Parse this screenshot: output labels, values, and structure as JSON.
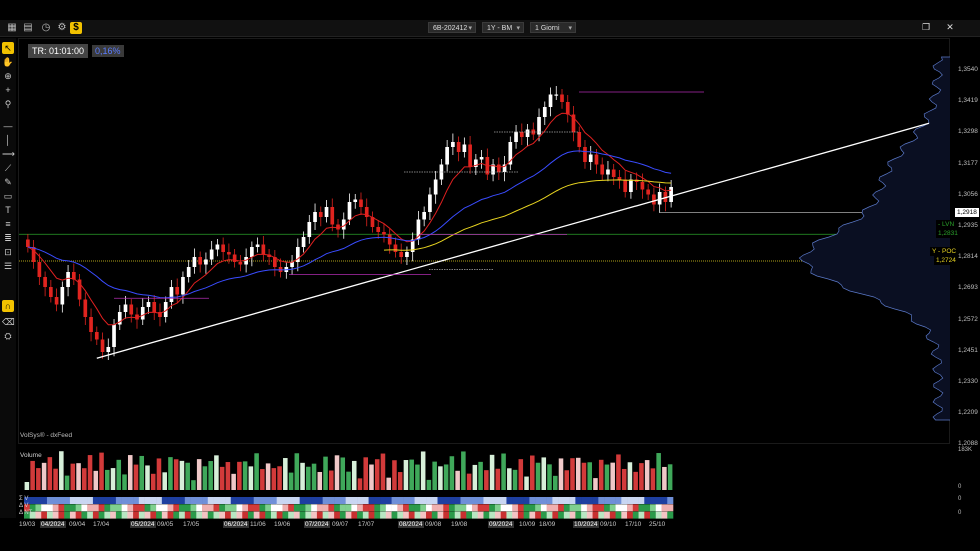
{
  "toolbar": {
    "contract": "6B-202412",
    "range": "1Y - BM",
    "interval": "1 Giorni"
  },
  "overlay": {
    "timer": "TR: 01:01:00",
    "change_pct": "0,16%"
  },
  "price_axis": {
    "ticks": [
      "1,3540",
      "1,3419",
      "1,3298",
      "1,3177",
      "1,3056",
      "1,2935",
      "1,2814",
      "1,2693",
      "1,2572",
      "1,2451",
      "1,2330",
      "1,2209",
      "1,2088"
    ],
    "last_price": "1,2918",
    "lvn_label": "- LVN",
    "lvn_value": "1,2831",
    "poc_label": "Y - POC",
    "poc_value": "1,2724"
  },
  "source": "VolSys® - dxFeed",
  "volume": {
    "label": "Volume",
    "axis_top": "183K",
    "axis_bottom": "0"
  },
  "heatmap": {
    "rows": [
      "Σ V",
      "Δ V",
      "Δ NT"
    ],
    "axis_top": "0",
    "axis_bottom": "0"
  },
  "dates": [
    {
      "t": "19/03",
      "hl": false
    },
    {
      "t": "04/2024",
      "hl": true
    },
    {
      "t": "09/04",
      "hl": false
    },
    {
      "t": "17/04",
      "hl": false
    },
    {
      "t": "05/2024",
      "hl": true
    },
    {
      "t": "09/05",
      "hl": false
    },
    {
      "t": "17/05",
      "hl": false
    },
    {
      "t": "06/2024",
      "hl": true
    },
    {
      "t": "11/06",
      "hl": false
    },
    {
      "t": "19/06",
      "hl": false
    },
    {
      "t": "07/2024",
      "hl": true
    },
    {
      "t": "09/07",
      "hl": false
    },
    {
      "t": "17/07",
      "hl": false
    },
    {
      "t": "08/2024",
      "hl": true
    },
    {
      "t": "09/08",
      "hl": false
    },
    {
      "t": "19/08",
      "hl": false
    },
    {
      "t": "09/2024",
      "hl": true
    },
    {
      "t": "10/09",
      "hl": false
    },
    {
      "t": "18/09",
      "hl": false
    },
    {
      "t": "10/2024",
      "hl": true
    },
    {
      "t": "09/10",
      "hl": false
    },
    {
      "t": "17/10",
      "hl": false
    },
    {
      "t": "25/10",
      "hl": false
    }
  ],
  "colors": {
    "bull": "#ffffff",
    "bear": "#e0241f",
    "ema_fast": "#e02020",
    "ema_mid": "#3a4cff",
    "ema_slow": "#e8d420",
    "trendline": "#ffffff",
    "profile": "#5a78c8",
    "poc": "#e8d420",
    "lvn": "#2aa02a"
  },
  "chart_data": {
    "type": "candlestick",
    "instrument": "6B-202412",
    "interval": "1 Giorni",
    "ylim": [
      1.2088,
      1.354
    ],
    "closes": [
      1.278,
      1.272,
      1.266,
      1.262,
      1.258,
      1.255,
      1.262,
      1.268,
      1.265,
      1.257,
      1.25,
      1.244,
      1.241,
      1.236,
      1.238,
      1.247,
      1.252,
      1.255,
      1.251,
      1.249,
      1.254,
      1.256,
      1.252,
      1.25,
      1.256,
      1.262,
      1.259,
      1.266,
      1.27,
      1.274,
      1.271,
      1.273,
      1.277,
      1.279,
      1.276,
      1.275,
      1.272,
      1.271,
      1.274,
      1.278,
      1.279,
      1.275,
      1.274,
      1.27,
      1.268,
      1.27,
      1.272,
      1.278,
      1.282,
      1.288,
      1.292,
      1.29,
      1.294,
      1.287,
      1.285,
      1.289,
      1.296,
      1.297,
      1.294,
      1.29,
      1.286,
      1.284,
      1.283,
      1.279,
      1.276,
      1.274,
      1.276,
      1.281,
      1.289,
      1.292,
      1.299,
      1.305,
      1.311,
      1.318,
      1.32,
      1.316,
      1.319,
      1.31,
      1.313,
      1.314,
      1.307,
      1.311,
      1.308,
      1.311,
      1.32,
      1.324,
      1.322,
      1.325,
      1.323,
      1.33,
      1.334,
      1.339,
      1.339,
      1.336,
      1.331,
      1.324,
      1.318,
      1.312,
      1.315,
      1.311,
      1.307,
      1.309,
      1.306,
      1.305,
      1.3,
      1.305,
      1.304,
      1.301,
      1.299,
      1.295,
      1.3,
      1.296,
      1.302
    ]
  }
}
